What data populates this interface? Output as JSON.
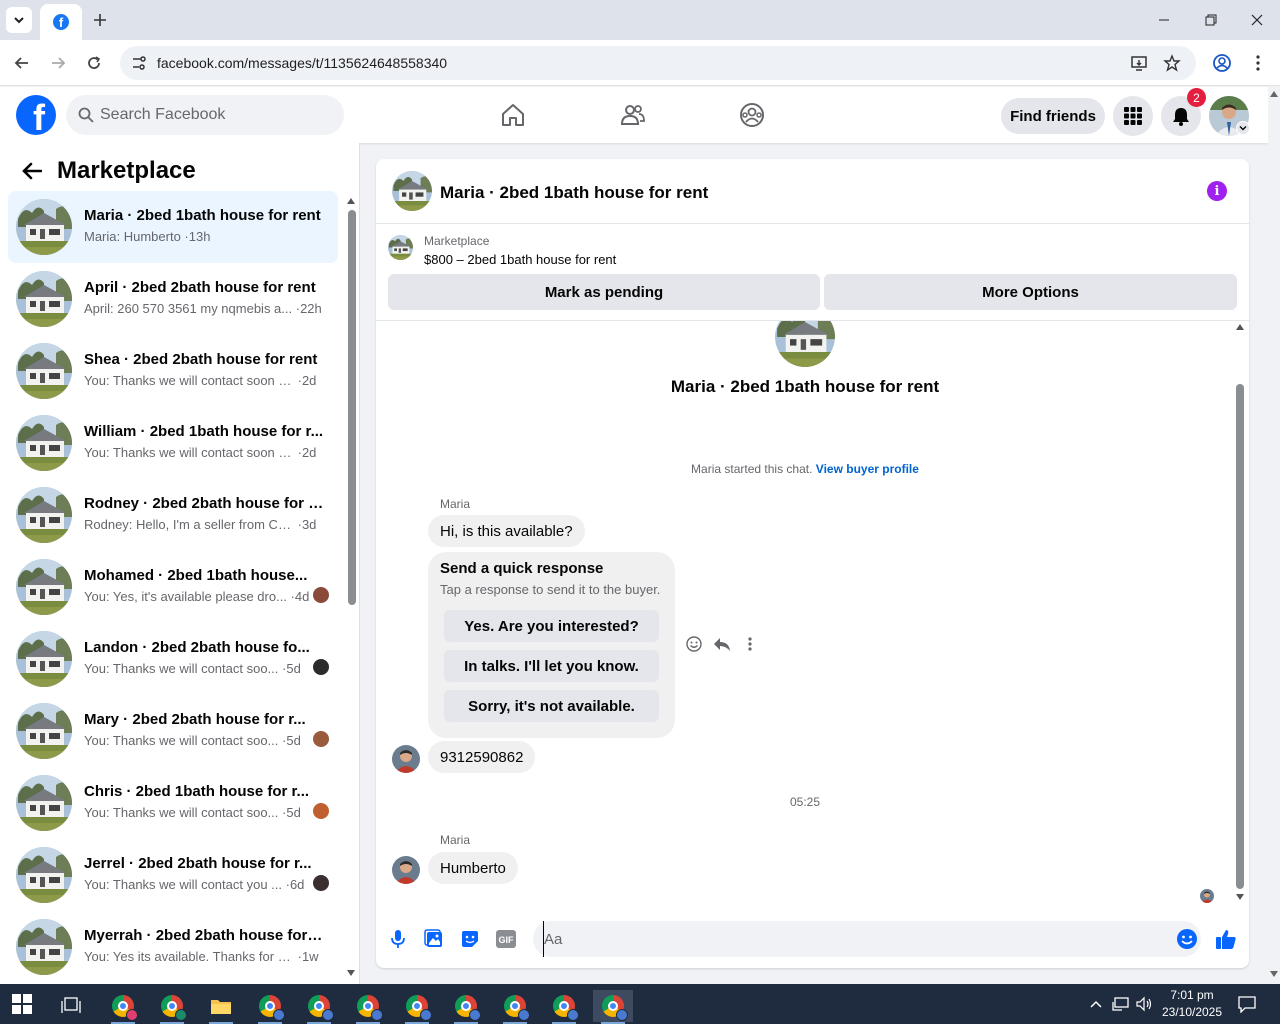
{
  "browser": {
    "url": "facebook.com/messages/t/1135624648558340"
  },
  "header": {
    "search_placeholder": "Search Facebook",
    "find_friends": "Find friends",
    "notification_count": "2"
  },
  "sidebar": {
    "title": "Marketplace",
    "conversations": [
      {
        "title": "Maria · 2bed 1bath house for rent",
        "snippet": "Maria: Humberto",
        "time": "13h",
        "active": true
      },
      {
        "title": "April · 2bed 2bath house for rent",
        "snippet": "April: 260 570 3561 my nqmebis a...",
        "time": "22h"
      },
      {
        "title": "Shea · 2bed 2bath house for rent",
        "snippet": "You: Thanks we will contact soon w...",
        "time": "2d"
      },
      {
        "title": "William · 2bed 1bath house for r...",
        "snippet": "You: Thanks we will contact soon w...",
        "time": "2d"
      },
      {
        "title": "Rodney · 2bed 2bath house for r...",
        "snippet": "Rodney: Hello, I'm a seller from Chi...",
        "time": "3d"
      },
      {
        "title": "Mohamed · 2bed 1bath house...",
        "snippet": "You: Yes, it's available please dro...",
        "time": "4d"
      },
      {
        "title": "Landon · 2bed 2bath house fo...",
        "snippet": "You: Thanks we will contact soo...",
        "time": "5d"
      },
      {
        "title": "Mary · 2bed 2bath house for r...",
        "snippet": "You: Thanks we will contact soo...",
        "time": "5d"
      },
      {
        "title": "Chris · 2bed 1bath house for r...",
        "snippet": "You: Thanks we will contact soo...",
        "time": "5d"
      },
      {
        "title": "Jerrel · 2bed 2bath house for r...",
        "snippet": "You: Thanks we will contact you ...",
        "time": "6d"
      },
      {
        "title": "Myerrah · 2bed 2bath house for ...",
        "snippet": "You: Yes its available. Thanks for m...",
        "time": "1w"
      }
    ]
  },
  "chat": {
    "title": "Maria · 2bed 1bath house for rent",
    "listing_label": "Marketplace",
    "listing_price": "$800 – 2bed 1bath house for rent",
    "mark_pending": "Mark as pending",
    "more_options": "More Options",
    "conversation_title": "Maria · 2bed 1bath house for rent",
    "started_text": "Maria started this chat.",
    "view_profile": "View buyer profile",
    "sender_name": "Maria",
    "msg1": "Hi, is this available?",
    "quick_title": "Send a quick response",
    "quick_sub": "Tap a response to send it to the buyer.",
    "quick_responses": [
      "Yes. Are you interested?",
      "In talks. I'll let you know.",
      "Sorry, it's not available."
    ],
    "msg2": "9312590862",
    "timestamp": "05:25",
    "msg3": "Humberto",
    "composer_placeholder": "Aa"
  },
  "taskbar": {
    "time": "7:01 pm",
    "date": "23/10/2025"
  },
  "colors": {
    "brand": "#0866ff",
    "badge": "#e41e3f",
    "info": "#a020f0"
  }
}
